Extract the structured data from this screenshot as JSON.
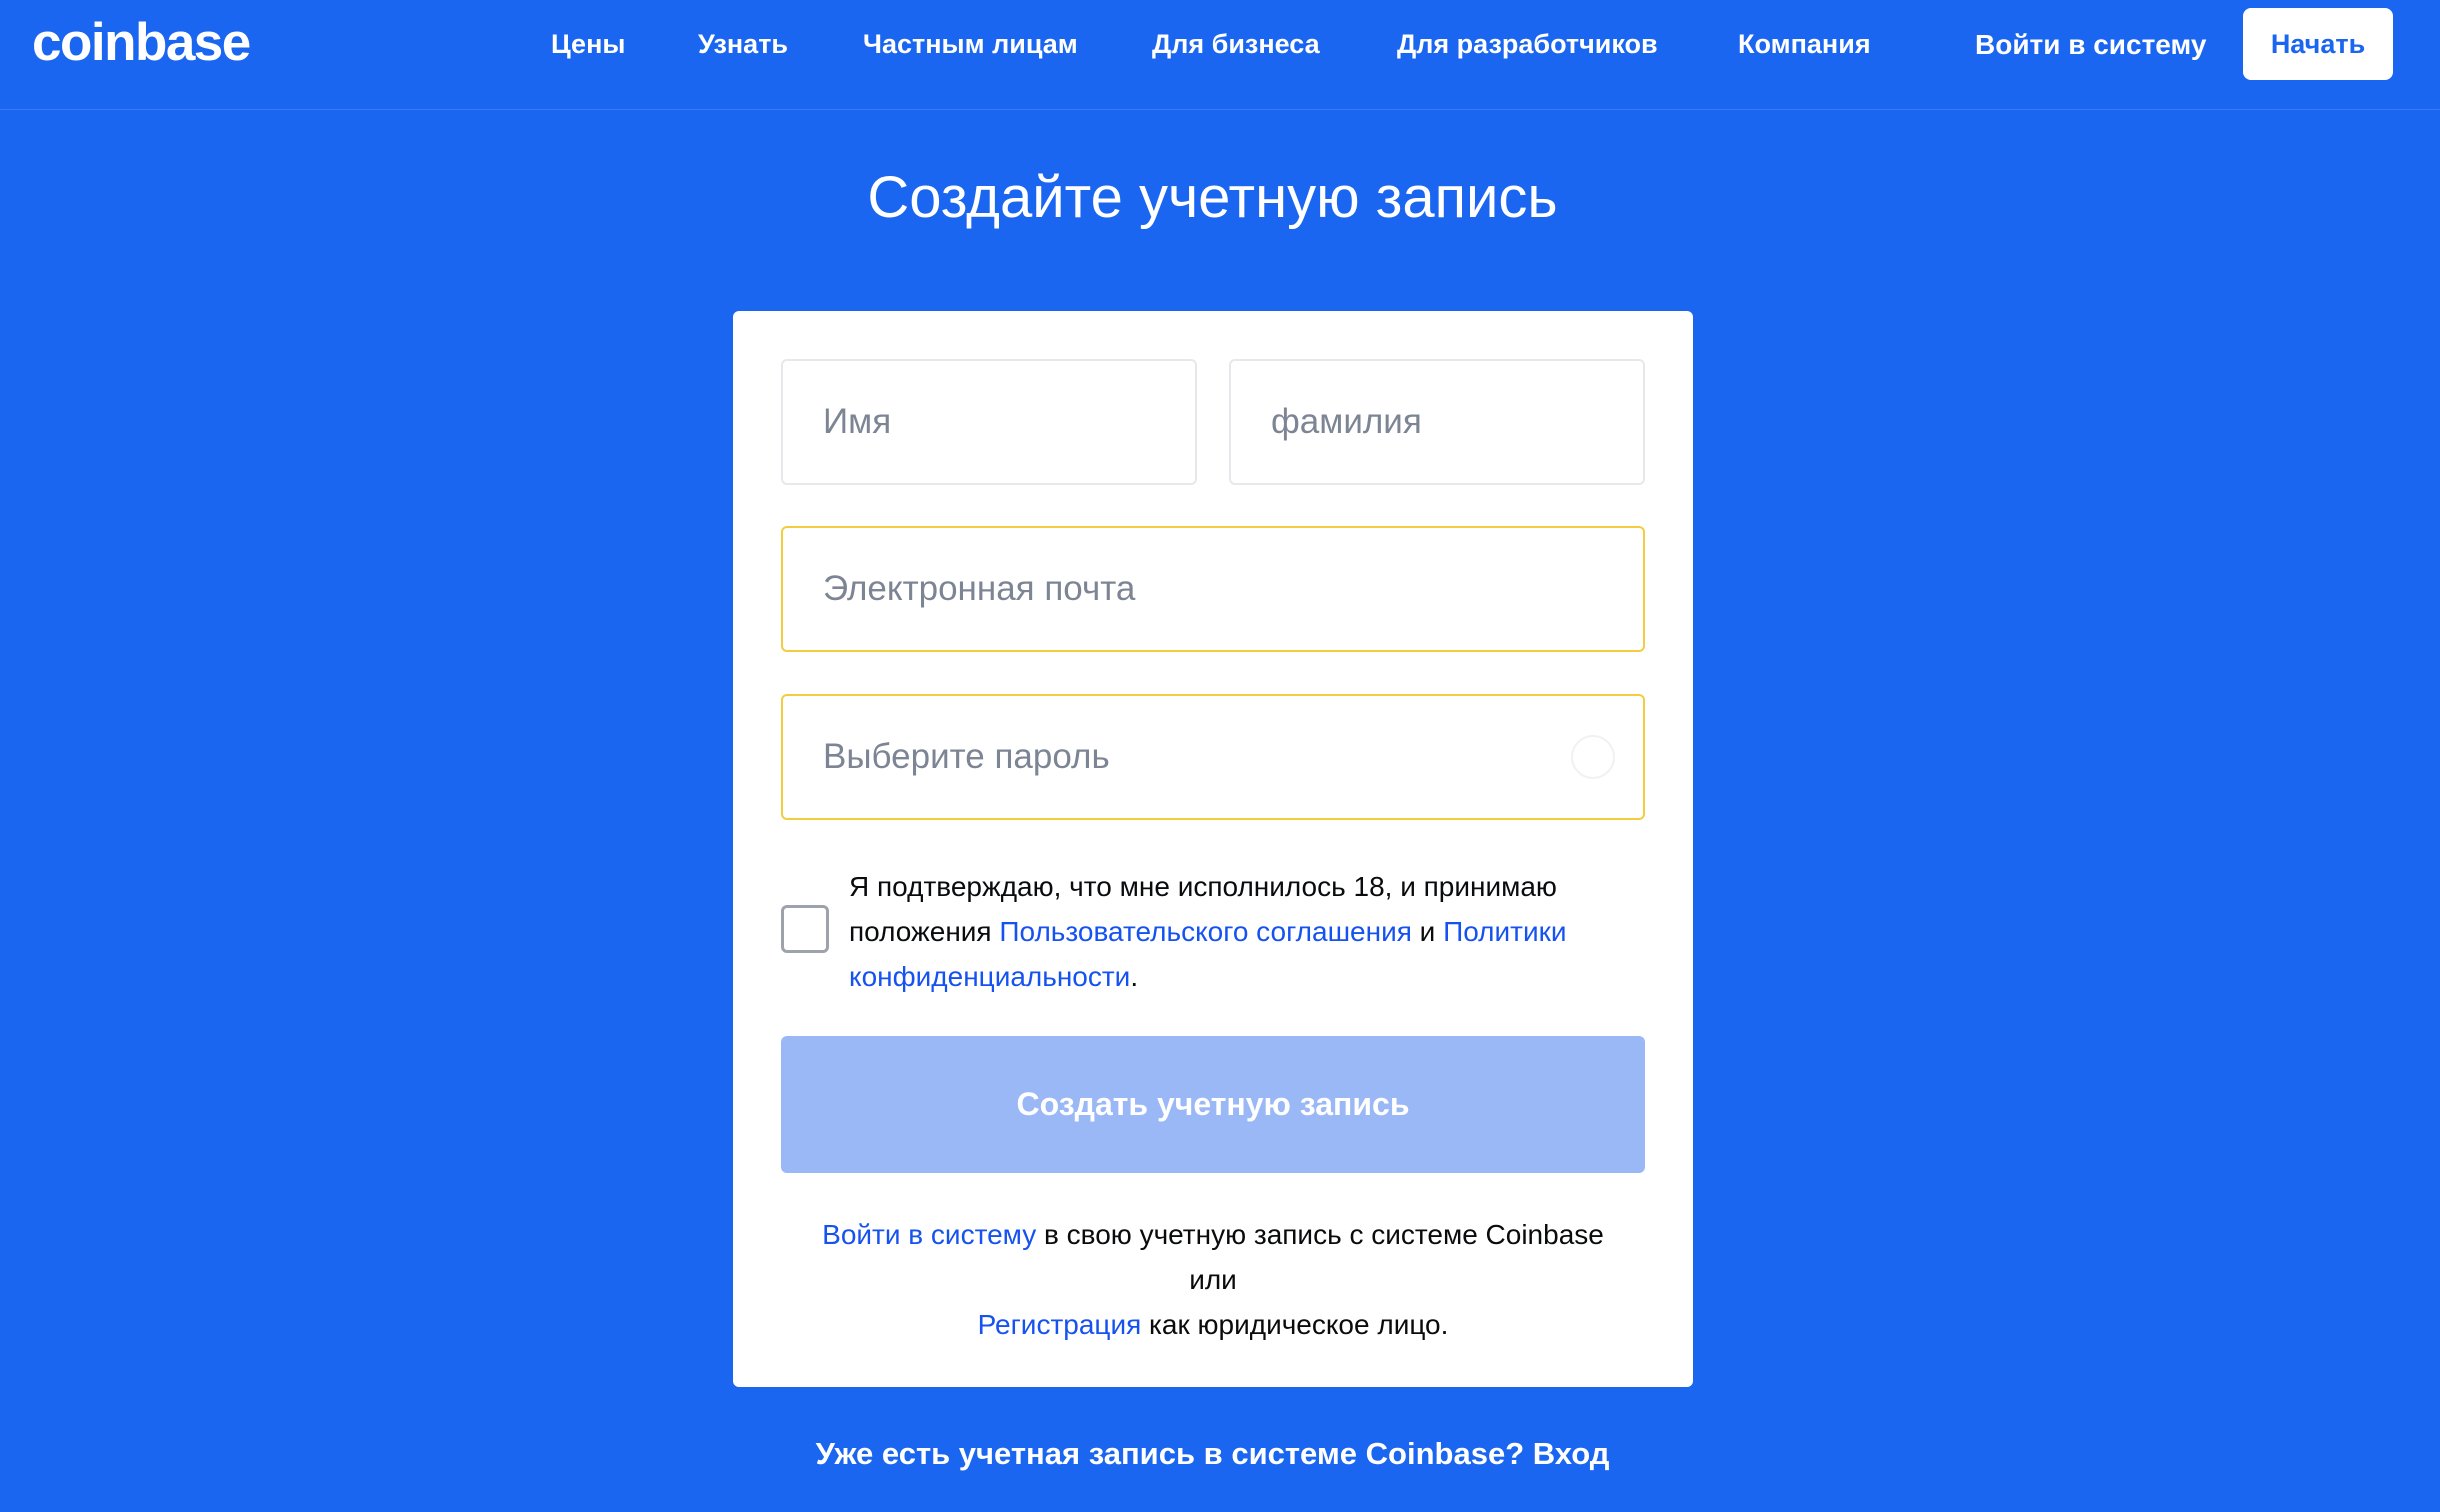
{
  "nav": {
    "logo": "coinbase",
    "links": [
      "Цены",
      "Узнать",
      "Частным лицам",
      "Для бизнеса",
      "Для разработчиков",
      "Компания"
    ],
    "signin": "Войти в систему",
    "start": "Начать"
  },
  "page": {
    "title": "Создайте учетную запись"
  },
  "form": {
    "first_name_placeholder": "Имя",
    "last_name_placeholder": "фамилия",
    "email_placeholder": "Электронная почта",
    "password_placeholder": "Выберите пароль",
    "consent": {
      "part1": "Я подтверждаю, что мне исполнилось 18, и принимаю положения ",
      "terms_link": "Пользовательского соглашения",
      "and": " и ",
      "privacy_link": "Политики конфиденциальности",
      "end": "."
    },
    "submit_label": "Создать учетную запись",
    "footer": {
      "signin_link": "Войти в систему",
      "signin_rest": " в свою учетную запись с системе Coinbase",
      "or": "или",
      "register_link": "Регистрация",
      "register_rest": " как юридическое лицо."
    }
  },
  "bottom": {
    "text": "Уже есть учетная запись в системе Coinbase? ",
    "link": "Вход"
  },
  "colors": {
    "background": "#1a66f0",
    "link": "#1652f0",
    "button_disabled": "#9bb8f6",
    "field_focus": "#f3cd3f"
  }
}
